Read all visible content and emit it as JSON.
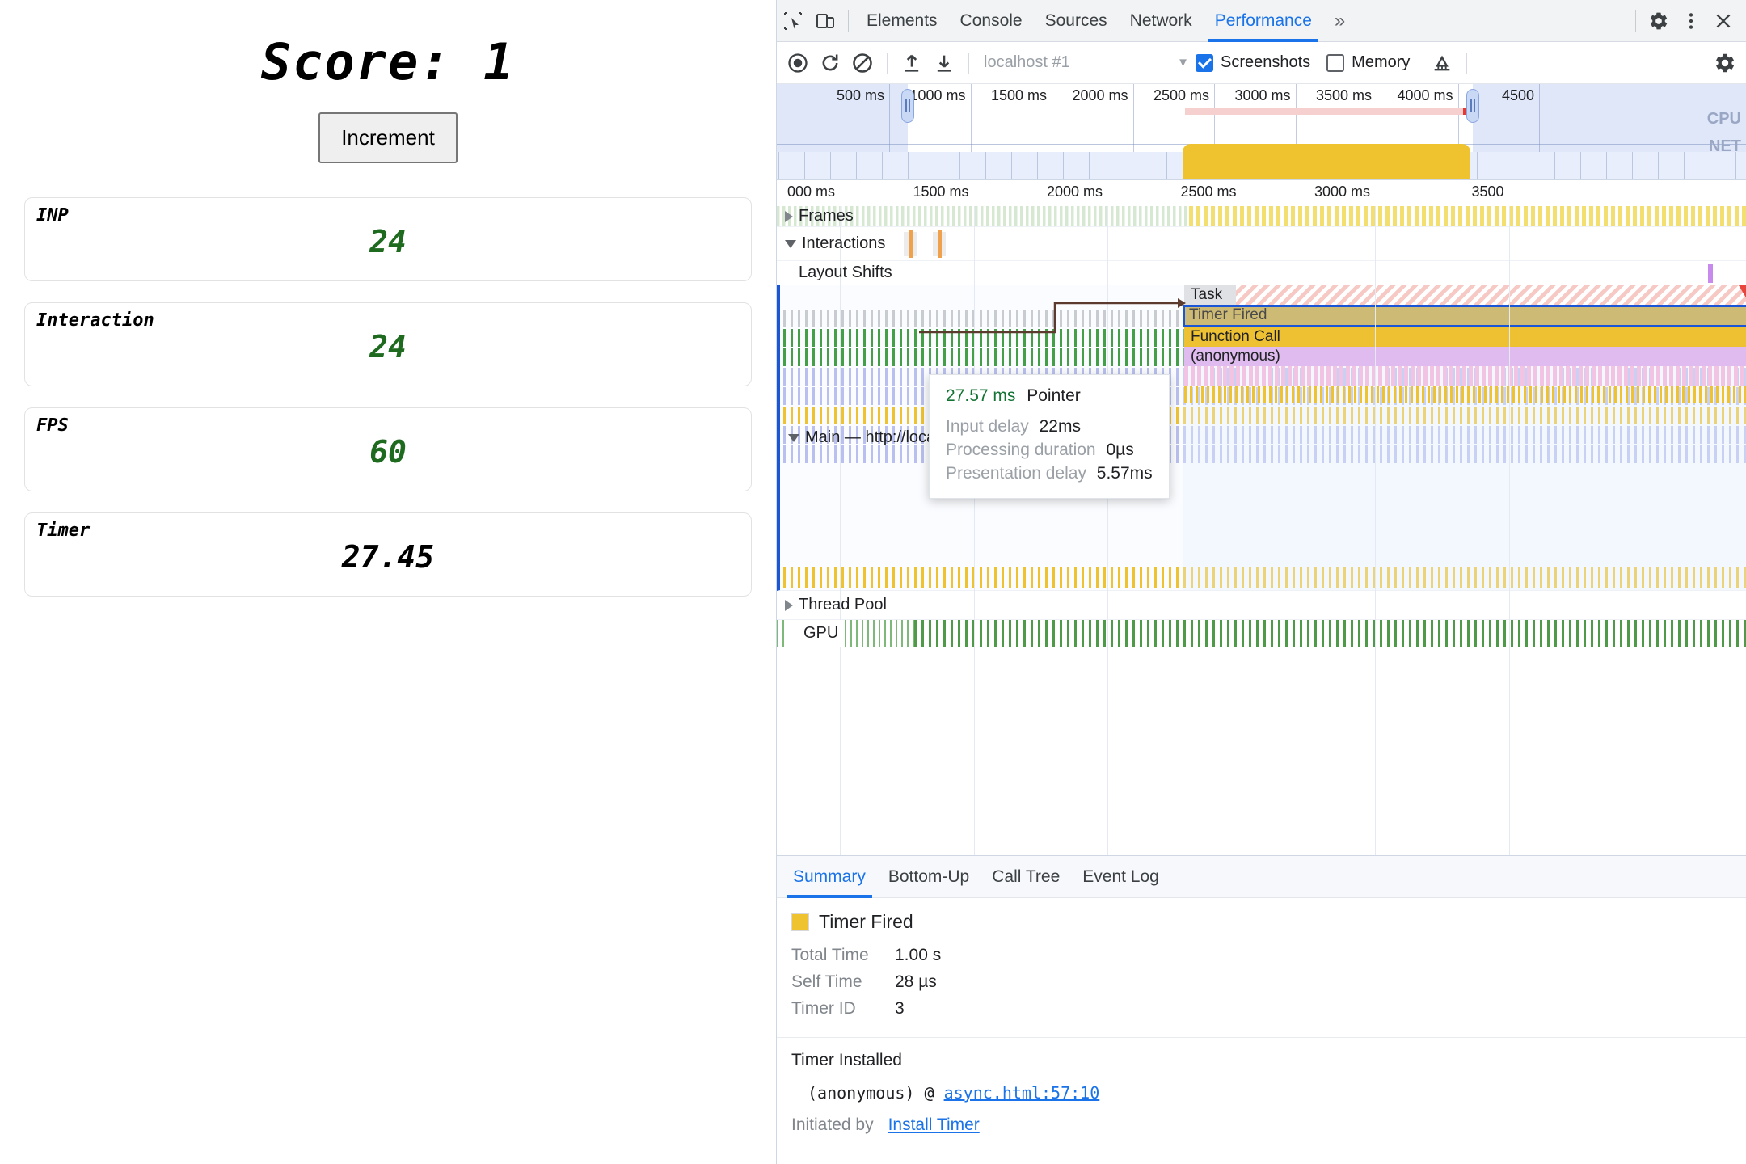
{
  "page": {
    "score_title": "Score: 1",
    "increment_label": "Increment",
    "metrics": [
      {
        "label": "INP",
        "value": "24",
        "color": "green"
      },
      {
        "label": "Interaction",
        "value": "24",
        "color": "green"
      },
      {
        "label": "FPS",
        "value": "60",
        "color": "green"
      },
      {
        "label": "Timer",
        "value": "27.45",
        "color": "black"
      }
    ]
  },
  "devtools": {
    "tabs": [
      {
        "label": "Elements",
        "active": false
      },
      {
        "label": "Console",
        "active": false
      },
      {
        "label": "Sources",
        "active": false
      },
      {
        "label": "Network",
        "active": false
      },
      {
        "label": "Performance",
        "active": true
      }
    ],
    "more_tabs_label": "»",
    "icons": {
      "inspect": "inspect-element-icon",
      "device": "device-toolbar-icon",
      "settings": "gear-icon",
      "more": "kebab-menu-icon",
      "close": "close-icon"
    },
    "toolbar": {
      "record_label": "record-icon",
      "reload_label": "reload-record-icon",
      "clear_label": "clear-icon",
      "upload_label": "upload-profile-icon",
      "download_label": "download-profile-icon",
      "session_value": "localhost #1",
      "screenshots_label": "Screenshots",
      "screenshots_checked": true,
      "memory_label": "Memory",
      "memory_checked": false,
      "gc_label": "collect-garbage-icon",
      "settings_label": "capture-settings-icon"
    },
    "overview": {
      "ticks": [
        "500 ms",
        "1000 ms",
        "1500 ms",
        "2000 ms",
        "2500 ms",
        "3000 ms",
        "3500 ms",
        "4000 ms",
        "4500"
      ],
      "cpu_label": "CPU",
      "net_label": "NET"
    },
    "flame_ruler_ticks": [
      "000 ms",
      "1500 ms",
      "2000 ms",
      "2500 ms",
      "3000 ms",
      "3500"
    ],
    "tracks": [
      {
        "name": "Frames",
        "expander": "right"
      },
      {
        "name": "Interactions",
        "expander": "down"
      },
      {
        "name": "Layout Shifts",
        "expander": "none"
      },
      {
        "name": "Main — http://localho                           ers/async.html",
        "expander": "down"
      },
      {
        "name": "Thread Pool",
        "expander": "right"
      },
      {
        "name": "GPU",
        "expander": "none"
      }
    ],
    "flame_bars": [
      {
        "label": "Task",
        "kind": "task"
      },
      {
        "label": "Timer Fired",
        "kind": "timer"
      },
      {
        "label": "Function Call",
        "kind": "fncall"
      },
      {
        "label": "(anonymous)",
        "kind": "anon"
      }
    ],
    "tooltip": {
      "duration": "27.57 ms",
      "title": "Pointer",
      "rows": [
        {
          "key": "Input delay",
          "value": "22ms"
        },
        {
          "key": "Processing duration",
          "value": "0µs"
        },
        {
          "key": "Presentation delay",
          "value": "5.57ms"
        }
      ]
    },
    "detail": {
      "tabs": [
        {
          "label": "Summary",
          "active": true
        },
        {
          "label": "Bottom-Up",
          "active": false
        },
        {
          "label": "Call Tree",
          "active": false
        },
        {
          "label": "Event Log",
          "active": false
        }
      ],
      "summary": {
        "event_name": "Timer Fired",
        "swatch_color": "#efc32f",
        "rows": [
          {
            "key": "Total Time",
            "value": "1.00 s"
          },
          {
            "key": "Self Time",
            "value": "28 µs"
          },
          {
            "key": "Timer ID",
            "value": "3"
          }
        ],
        "timer_installed_title": "Timer Installed",
        "stack_prefix": "(anonymous) @ ",
        "stack_link": "async.html:57:10",
        "initiated_by_key": "Initiated by",
        "initiated_by_link": "Install Timer"
      }
    },
    "colors": {
      "accent": "#1a73e8",
      "green_value": "#137333",
      "timer_yellow": "#efc32f",
      "anon_purple": "#dfbbef",
      "task_red": "#e8453c"
    }
  }
}
